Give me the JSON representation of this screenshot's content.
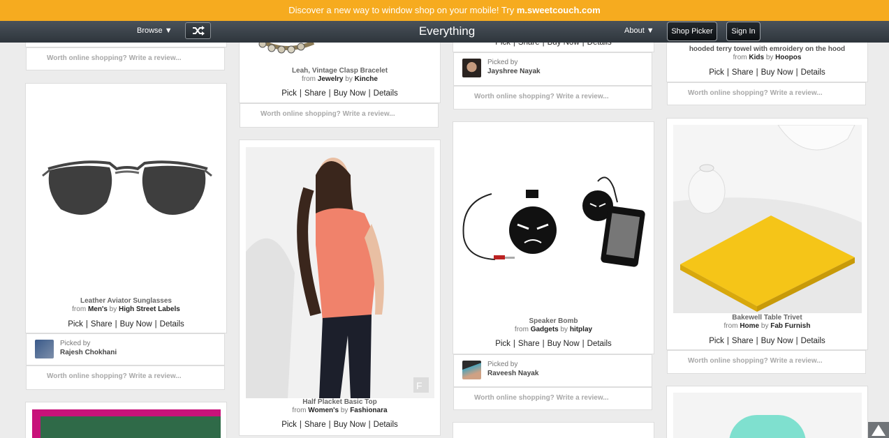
{
  "promo": {
    "text": "Discover a new way to window shop on your mobile! Try ",
    "link": "m.sweetcouch.com"
  },
  "nav": {
    "browse": "Browse ▼",
    "title": "Everything",
    "about": "About ▼",
    "shop_picker": "Shop Picker",
    "sign_in": "Sign In"
  },
  "common": {
    "review": "Worth online shopping? Write a review...",
    "picked_by": "Picked by",
    "from": "from",
    "by": "by",
    "pick": "Pick",
    "share": "Share",
    "buy_now": "Buy Now",
    "details": "Details",
    "sep": "|"
  },
  "products": {
    "sunglasses": {
      "name": "Leather Aviator Sunglasses",
      "category": "Men's",
      "store": "High Street Labels",
      "picker": "Rajesh Chokhani"
    },
    "bracelet": {
      "name": "Leah, Vintage Clasp Bracelet",
      "category": "Jewelry",
      "store": "Kinche"
    },
    "top": {
      "name": "Half Placket Basic Top",
      "category": "Women's",
      "store": "Fashionara"
    },
    "partial_col3": {
      "picker": "Jayshree Nayak"
    },
    "speaker": {
      "name": "Speaker Bomb",
      "category": "Gadgets",
      "store": "hitplay",
      "picker": "Raveesh Nayak"
    },
    "towel": {
      "name": "hooded terry towel with emroidery on the hood",
      "category": "Kids",
      "store": "Hoopos"
    },
    "trivet": {
      "name": "Bakewell Table Trivet",
      "category": "Home",
      "store": "Fab Furnish"
    }
  }
}
